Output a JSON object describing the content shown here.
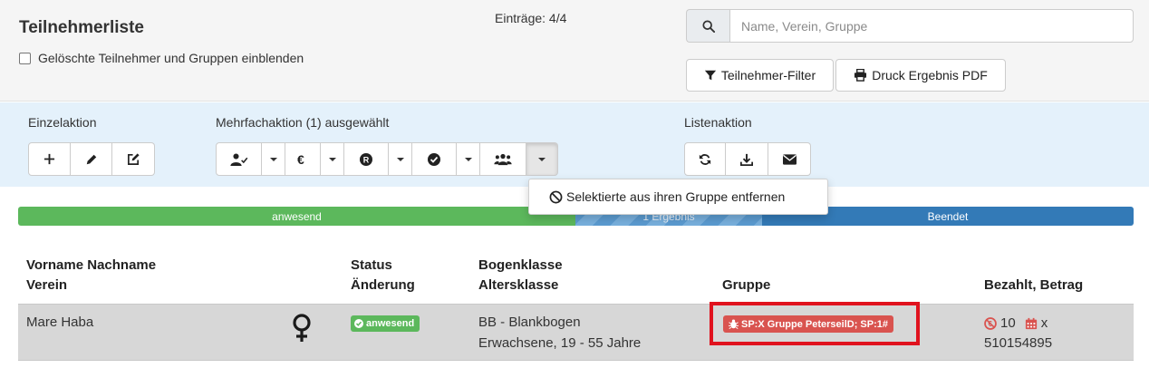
{
  "header": {
    "title": "Teilnehmerliste",
    "show_deleted_label": "Gelöschte Teilnehmer und Gruppen einblenden",
    "entries": "Einträge: 4/4"
  },
  "search": {
    "placeholder": "Name, Verein, Gruppe",
    "value": ""
  },
  "toolbar": {
    "filter_label": "Teilnehmer-Filter",
    "print_label": "Druck Ergebnis PDF"
  },
  "actions": {
    "single_label": "Einzelaktion",
    "multi_label": "Mehrfachaktion (1) ausgewählt",
    "list_label": "Listenaktion"
  },
  "dropdown": {
    "item_remove_from_group": "Selektierte aus ihren Gruppe entfernen"
  },
  "progress": {
    "segments": [
      {
        "label": "anwesend",
        "color": "#5cb85c"
      },
      {
        "label": "1 Ergebnis",
        "color": "#5b9bd1"
      },
      {
        "label": "Beendet",
        "color": "#337ab7"
      }
    ]
  },
  "table": {
    "headers": {
      "name": "Vorname Nachname",
      "club": "Verein",
      "status": "Status",
      "change": "Änderung",
      "bowclass": "Bogenklasse",
      "ageclass": "Altersklasse",
      "group": "Gruppe",
      "paid": "Bezahlt, Betrag"
    },
    "rows": [
      {
        "name": "Mare Haba",
        "gender_icon": "female-icon",
        "status": "anwesend",
        "bowclass": "BB - Blankbogen",
        "ageclass": "Erwachsene, 19 - 55 Jahre",
        "group": "SP:X Gruppe PeterseilD; SP:1#",
        "paid_amount": "10",
        "paid_suffix": "x",
        "paid_id": "510154895"
      }
    ]
  },
  "colors": {
    "success": "#5cb85c",
    "danger": "#d9534f",
    "primary": "#337ab7",
    "highlight": "#e0121e"
  }
}
